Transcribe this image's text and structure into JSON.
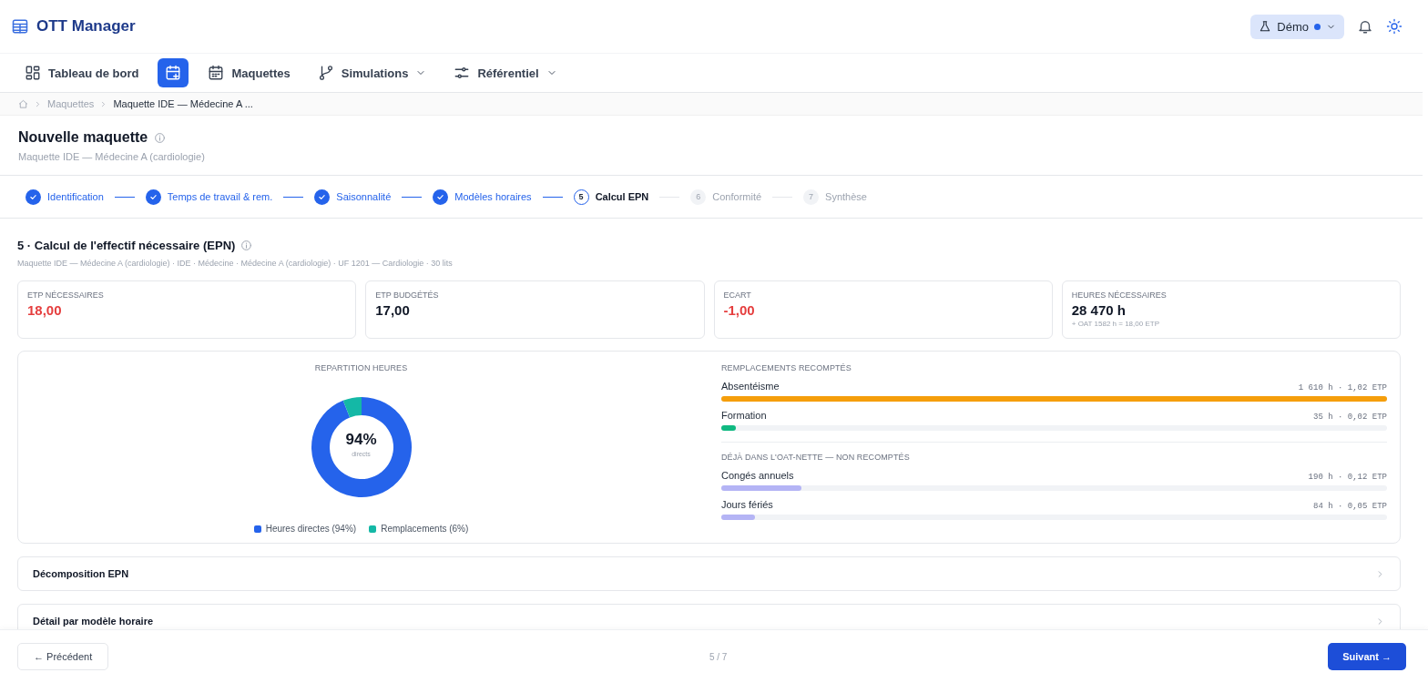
{
  "app": {
    "title": "OTT Manager"
  },
  "header_actions": {
    "mode_label": "Démo"
  },
  "nav": [
    {
      "label": "Tableau de bord",
      "selected": false,
      "menu": false
    },
    {
      "selected": true,
      "menu": false
    },
    {
      "label": "Maquettes",
      "selected": false,
      "menu": false
    },
    {
      "label": "Simulations",
      "selected": false,
      "menu": true
    },
    {
      "label": "Référentiel",
      "selected": false,
      "menu": true
    }
  ],
  "breadcrumb": [
    "Maquettes",
    "Maquette IDE — Médecine A ..."
  ],
  "page": {
    "title": "Nouvelle maquette",
    "subtitle": "Maquette IDE — Médecine A (cardiologie)"
  },
  "steps": [
    {
      "label": "Identification",
      "completed": true,
      "selected": false
    },
    {
      "label": "Temps de travail & rem.",
      "completed": true,
      "selected": false
    },
    {
      "label": "Saisonnalité",
      "completed": true,
      "selected": false
    },
    {
      "label": "Modèles horaires",
      "completed": true,
      "selected": false
    },
    {
      "number": "5",
      "label": "Calcul EPN",
      "completed": false,
      "selected": true
    },
    {
      "number": "6",
      "label": "Conformité",
      "completed": false,
      "selected": false
    },
    {
      "number": "7",
      "label": "Synthèse",
      "completed": false,
      "selected": false
    }
  ],
  "section": {
    "title": "5 · Calcul de l'effectif nécessaire (EPN)",
    "context": "Maquette IDE — Médecine A (cardiologie) · IDE · Médecine · Médecine A (cardiologie) · UF 1201 — Cardiologie · 30 lits"
  },
  "kpis": [
    {
      "label": "ETP NÉCESSAIRES",
      "value": "18,00",
      "negative": true
    },
    {
      "label": "ETP BUDGÉTÉS",
      "value": "17,00",
      "negative": false
    },
    {
      "label": "ECART",
      "value": "-1,00",
      "negative": true
    },
    {
      "label": "HEURES NÉCESSAIRES",
      "value": "28 470 h",
      "negative": false,
      "note": "+ OAT 1582 h = 18,00 ETP"
    }
  ],
  "distribution": {
    "title": "REPARTITION HEURES",
    "center_value": "94%",
    "center_label": "directs",
    "chart_data": {
      "type": "donut",
      "values": [
        94,
        6
      ]
    },
    "legend": [
      {
        "label": "Heures directes (94%)",
        "color": "#2563eb"
      },
      {
        "label": "Remplacements (6%)",
        "color": "#14b8a6"
      }
    ]
  },
  "replacement_groups": [
    {
      "title": "REMPLACEMENTS RECOMPTÉS",
      "items": [
        {
          "label": "Absentéisme",
          "reading": "1 610 h · 1,02 ETP",
          "level": 1,
          "color": "#f59e0b"
        },
        {
          "label": "Formation",
          "reading": "35 h · 0,02 ETP",
          "level": 0.02,
          "color": "#10b981"
        }
      ]
    },
    {
      "title": "DÉJÀ DANS L'OAT-NETTE — NON RECOMPTÉS",
      "items": [
        {
          "label": "Congés annuels",
          "reading": "190 h · 0,12 ETP",
          "level": 0.12,
          "color": "#b4b4f5"
        },
        {
          "label": "Jours fériés",
          "reading": "84 h · 0,05 ETP",
          "level": 0.05,
          "color": "#b4b4f5"
        }
      ]
    }
  ],
  "accordions": [
    {
      "title": "Décomposition EPN",
      "expanded": false
    },
    {
      "title": "Détail par modèle horaire",
      "expanded": false
    }
  ],
  "footer": {
    "previous": "← Précédent",
    "progress": "5 / 7",
    "next": "Suivant →"
  }
}
